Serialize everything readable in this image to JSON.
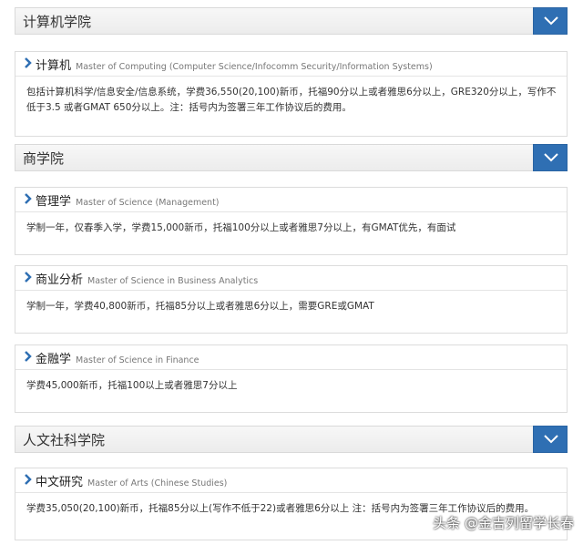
{
  "sections": [
    {
      "title": "计算机学院",
      "programs": [
        {
          "name_cn": "计算机",
          "name_en": "Master of Computing (Computer Science/Infocomm Security/Information Systems)",
          "desc": "包括计算机科学/信息安全/信息系统，学费36,550(20,100)新币，托福90分以上或者雅思6分以上，GRE320分以上，写作不低于3.5 或者GMAT 650分以上。注：括号内为签署三年工作协议后的费用。"
        }
      ]
    },
    {
      "title": "商学院",
      "programs": [
        {
          "name_cn": "管理学",
          "name_en": "Master of Science (Management)",
          "desc": "学制一年，仅春季入学，学费15,000新币，托福100分以上或者雅思7分以上，有GMAT优先，有面试"
        },
        {
          "name_cn": "商业分析",
          "name_en": "Master of Science in Business Analytics",
          "desc": "学制一年，学费40,800新币，托福85分以上或者雅思6分以上，需要GRE或GMAT"
        },
        {
          "name_cn": "金融学",
          "name_en": "Master of Science in Finance",
          "desc": "学费45,000新币，托福100以上或者雅思7分以上"
        }
      ]
    },
    {
      "title": "人文社科学院",
      "programs": [
        {
          "name_cn": "中文研究",
          "name_en": "Master of Arts (Chinese Studies)",
          "desc": "学费35,050(20,100)新币，托福85分以上(写作不低于22)或者雅思6分以上 注：括号内为签署三年工作协议后的费用。"
        }
      ]
    }
  ],
  "watermark": "头条 @金吉列留学长春",
  "colors": {
    "toggle": "#2f6fb3",
    "chevron": "#2f6fb3"
  }
}
